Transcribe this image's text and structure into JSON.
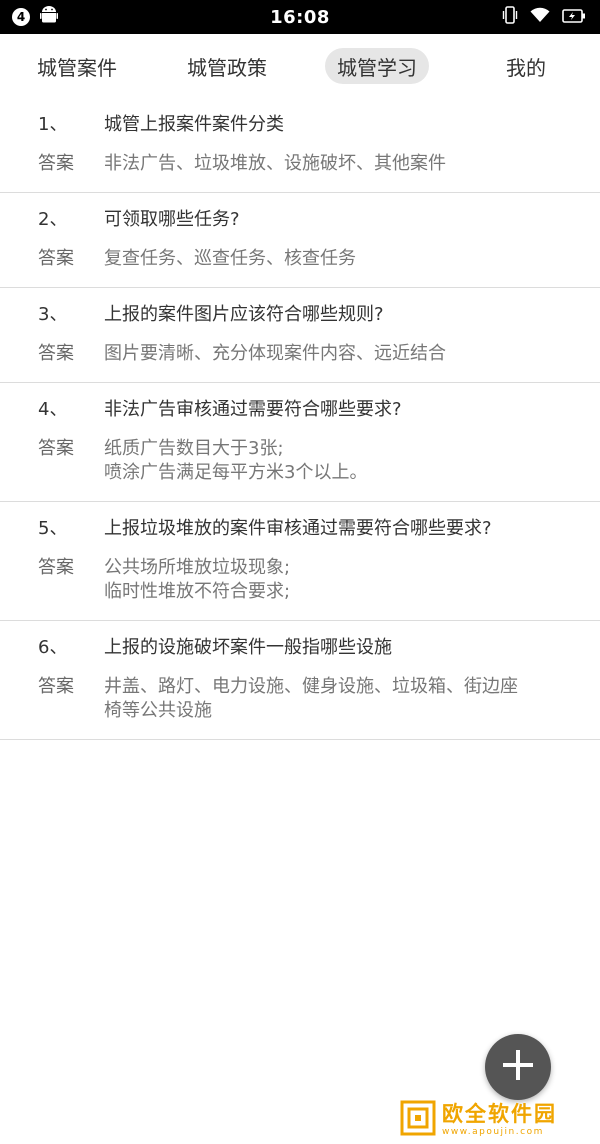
{
  "status_bar": {
    "notification_count": "4",
    "time": "16:08"
  },
  "tabs": [
    {
      "label": "城管案件",
      "active": false
    },
    {
      "label": "城管政策",
      "active": false
    },
    {
      "label": "城管学习",
      "active": true
    },
    {
      "label": "我的",
      "active": false
    }
  ],
  "answer_label": "答案",
  "qa_items": [
    {
      "number": "1、",
      "question": "城管上报案件案件分类",
      "answer_lines": [
        "非法广告、垃圾堆放、设施破坏、其他案件"
      ]
    },
    {
      "number": "2、",
      "question": "可领取哪些任务?",
      "answer_lines": [
        "复查任务、巡查任务、核查任务"
      ]
    },
    {
      "number": "3、",
      "question": "上报的案件图片应该符合哪些规则?",
      "answer_lines": [
        "图片要清晰、充分体现案件内容、远近结合"
      ]
    },
    {
      "number": "4、",
      "question": "非法广告审核通过需要符合哪些要求?",
      "answer_lines": [
        "纸质广告数目大于3张;",
        "喷涂广告满足每平方米3个以上。"
      ]
    },
    {
      "number": "5、",
      "question": "上报垃圾堆放的案件审核通过需要符合哪些要求?",
      "answer_lines": [
        "公共场所堆放垃圾现象;",
        "临时性堆放不符合要求;"
      ]
    },
    {
      "number": "6、",
      "question": "上报的设施破坏案件一般指哪些设施",
      "answer_lines": [
        "井盖、路灯、电力设施、健身设施、垃圾箱、街边座",
        "椅等公共设施"
      ]
    }
  ],
  "fab": {
    "icon": "plus-icon"
  },
  "watermark": {
    "text": "欧全软件园",
    "url": "www.apoujin.com"
  },
  "colors": {
    "fab": "#555555",
    "active_tab_bg": "#e6e6e6",
    "watermark": "#f0a500"
  }
}
